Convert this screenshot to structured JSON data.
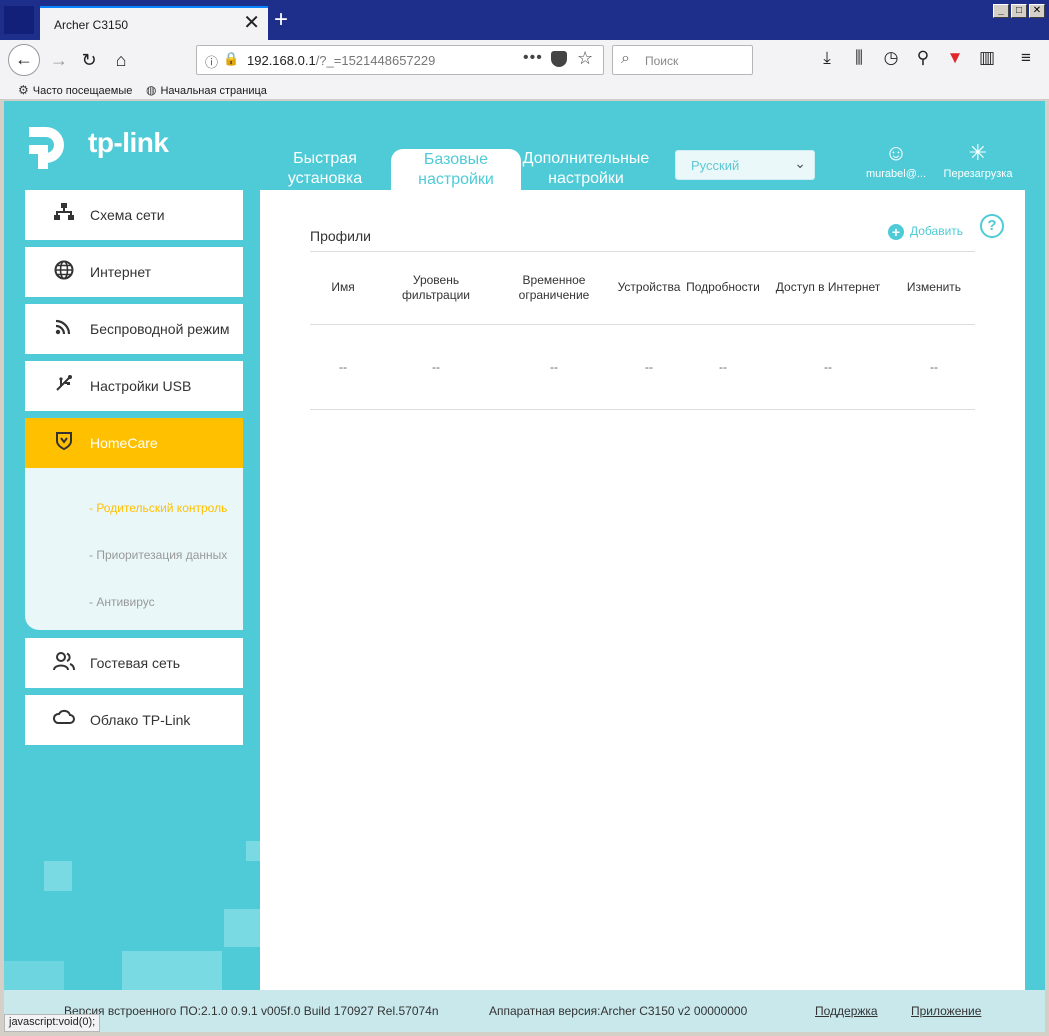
{
  "browser": {
    "tab_title": "Archer C3150",
    "tab_close": "✕",
    "new_tab": "+",
    "url_host": "192.168.0.1",
    "url_path": "/?_=1521448657229",
    "search_placeholder": "Поиск",
    "bookmarks": [
      "Часто посещаемые",
      "Начальная страница"
    ],
    "status_text": "javascript:void(0);"
  },
  "header": {
    "logo_text": "tp-link",
    "nav": [
      {
        "label_line1": "Быстрая",
        "label_line2": "установка"
      },
      {
        "label_line1": "Базовые",
        "label_line2": "настройки"
      },
      {
        "label_line1": "Дополнительные",
        "label_line2": "настройки"
      }
    ],
    "language": "Русский",
    "account_label": "murabel@...",
    "reboot_label": "Перезагрузка"
  },
  "sidebar": {
    "items": [
      {
        "label": "Схема сети",
        "icon": "network-map-icon"
      },
      {
        "label": "Интернет",
        "icon": "globe-icon"
      },
      {
        "label": "Беспроводной режим",
        "icon": "wireless-icon"
      },
      {
        "label": "Настройки USB",
        "icon": "usb-icon"
      },
      {
        "label": "HomeCare",
        "icon": "homecare-shield-icon"
      },
      {
        "label": "Гостевая сеть",
        "icon": "guests-icon"
      },
      {
        "label": "Облако TP-Link",
        "icon": "cloud-icon"
      }
    ],
    "submenu": [
      "- Родительский контроль",
      "- Приоритезация данных",
      "- Антивирус"
    ]
  },
  "main": {
    "section_title": "Профили",
    "add_label": "Добавить",
    "help": "?",
    "columns": [
      {
        "line1": "Имя",
        "line2": ""
      },
      {
        "line1": "Уровень",
        "line2": "фильтрации"
      },
      {
        "line1": "Временное",
        "line2": "ограничение"
      },
      {
        "line1": "Устройства",
        "line2": ""
      },
      {
        "line1": "Подробности",
        "line2": ""
      },
      {
        "line1": "Доступ в Интернет",
        "line2": ""
      },
      {
        "line1": "Изменить",
        "line2": ""
      }
    ],
    "rows": [
      [
        "--",
        "--",
        "--",
        "--",
        "--",
        "--",
        "--"
      ]
    ]
  },
  "footer": {
    "firmware": "Версия встроенного ПО:2.1.0 0.9.1 v005f.0 Build 170927 Rel.57074n",
    "hardware": "Аппаратная версия:Archer C3150 v2 00000000",
    "support": "Поддержка",
    "app": "Приложение"
  },
  "colors": {
    "accent": "#4ecbd7",
    "active_menu": "#ffc000"
  }
}
